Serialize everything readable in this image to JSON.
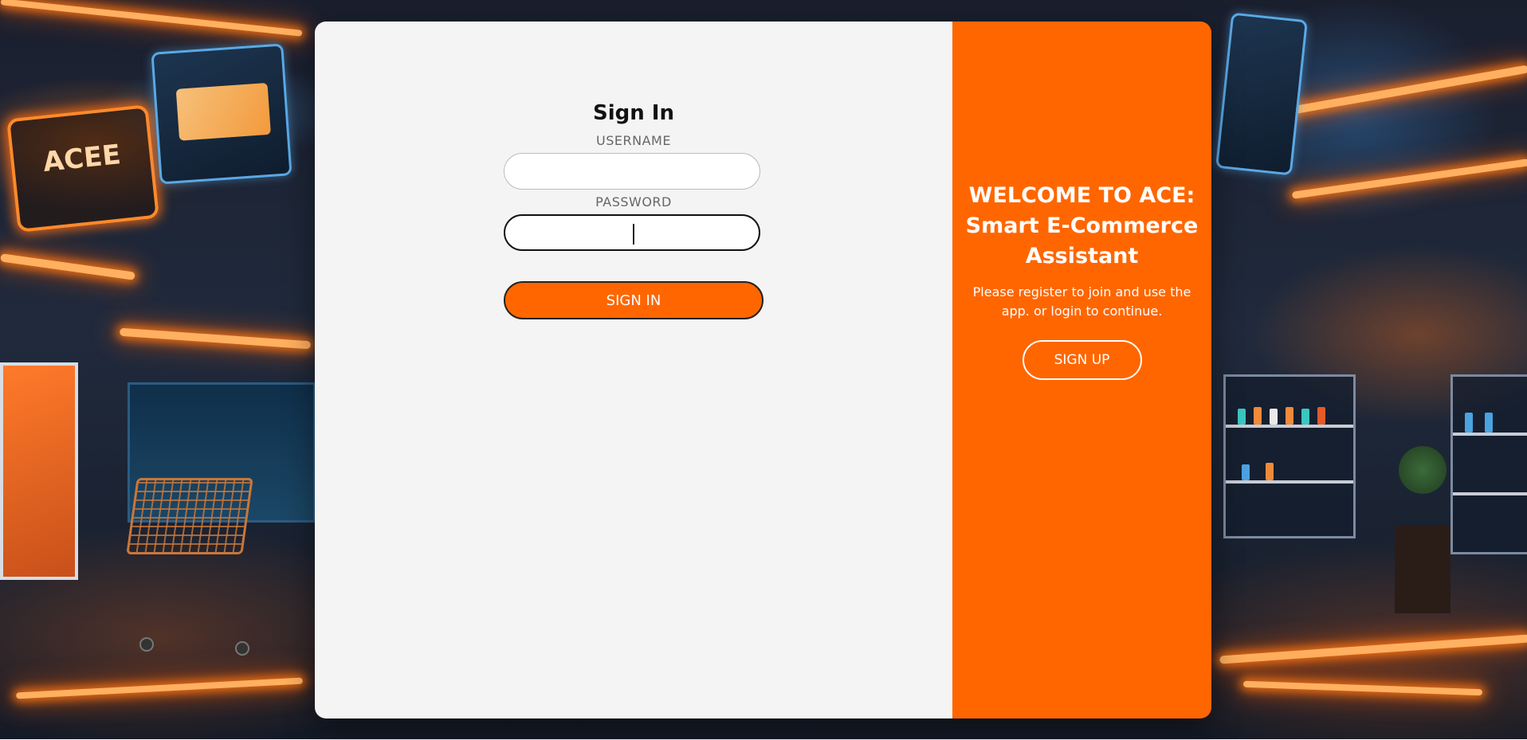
{
  "background": {
    "sign_text": "ACEE",
    "accent_glow": "#ff7a1a",
    "screen_glow": "#5aa9e6"
  },
  "signin": {
    "title": "Sign In",
    "username_label": "USERNAME",
    "username_value": "",
    "password_label": "PASSWORD",
    "password_value": "",
    "button_label": "SIGN IN"
  },
  "welcome": {
    "title": "WELCOME TO ACE: Smart E-Commerce Assistant",
    "text": "Please register to join and use the app. or login to continue.",
    "button_label": "SIGN UP"
  },
  "colors": {
    "primary": "#ff6600",
    "panel_bg": "#f4f4f4",
    "text_dark": "#111111",
    "label_gray": "#666666"
  }
}
